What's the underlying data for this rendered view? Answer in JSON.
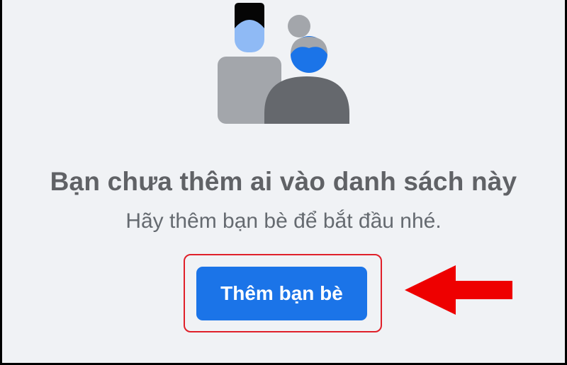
{
  "empty_state": {
    "illustration_icon": "friends-illustration-icon",
    "title": "Bạn chưa thêm ai vào danh sách này",
    "subtitle": "Hãy thêm bạn bè để bắt đầu nhé.",
    "button_label": "Thêm bạn bè"
  },
  "annotation": {
    "highlight_color": "#e0202a",
    "arrow_icon": "left-arrow-icon",
    "arrow_color": "#ee0000"
  },
  "colors": {
    "background": "#f0f2f5",
    "button": "#1b74e8",
    "title": "#606266",
    "subtitle": "#656a70"
  }
}
